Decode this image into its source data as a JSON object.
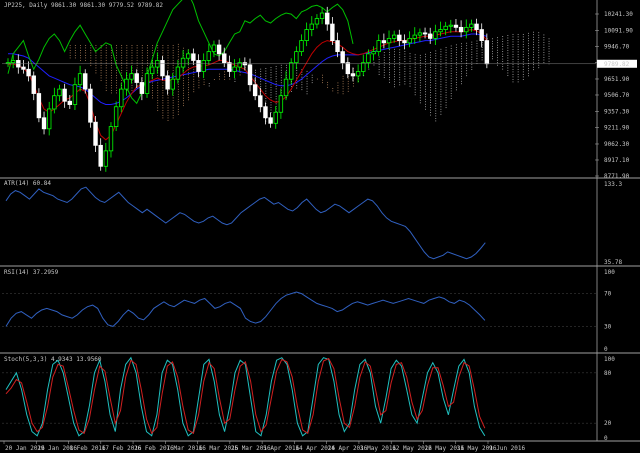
{
  "colors": {
    "background": "#000000",
    "separator": "#a0a0a0",
    "grid": "#3a3a3a",
    "text": "#c8c8c8",
    "bull_candle": "#00ff00",
    "bear_candle": "#ffffff",
    "tenkan": "#c00000",
    "kijun": "#2020ff",
    "chikou": "#00c000",
    "cloud_bull": "#d8d8d8",
    "cloud_bear": "#d8a070",
    "atr": "#3060c0",
    "rsi": "#3060c0",
    "stoch_main": "#20c0c0",
    "stoch_signal": "#d02020",
    "price_marker_bg": "#ffffff",
    "price_marker_text": "#000000"
  },
  "header": {
    "main": "JP225, Daily  9861.30 9861.30 9779.52 9789.82",
    "atr": "ATR(14) 60.84",
    "rsi": "RSI(14) 37.2959",
    "stoch": "Stoch(5,3,3) 4.9343 13.9560"
  },
  "price_marker": "9789.82",
  "chart_data": [
    {
      "type": "candlestick",
      "symbol": "JP225",
      "timeframe": "Daily",
      "yticks": [
        "10241.30",
        "10091.90",
        "9946.70",
        "9801.30",
        "9651.90",
        "9506.70",
        "9357.30",
        "9211.90",
        "9062.30",
        "8917.10",
        "8771.90"
      ],
      "ylim": [
        8771.9,
        10241.3
      ],
      "close": [
        9800,
        9820,
        9760,
        9740,
        9680,
        9520,
        9300,
        9200,
        9380,
        9500,
        9560,
        9450,
        9420,
        9600,
        9700,
        9560,
        9260,
        9050,
        8860,
        9000,
        9220,
        9400,
        9560,
        9650,
        9700,
        9620,
        9520,
        9700,
        9760,
        9820,
        9680,
        9560,
        9650,
        9760,
        9840,
        9880,
        9820,
        9720,
        9820,
        9900,
        9960,
        9880,
        9800,
        9720,
        9760,
        9800,
        9780,
        9600,
        9500,
        9400,
        9300,
        9250,
        9350,
        9500,
        9650,
        9800,
        9900,
        10000,
        10100,
        10150,
        10200,
        10250,
        10150,
        10000,
        9900,
        9800,
        9700,
        9680,
        9720,
        9800,
        9880,
        9900,
        10000,
        9980,
        10020,
        10050,
        10000,
        9980,
        10020,
        10050,
        10070,
        10060,
        10020,
        10080,
        10100,
        10130,
        10140,
        10120,
        10080,
        10120,
        10150,
        10100,
        10000,
        9790
      ],
      "ichimoku": {
        "tenkan": [
          9780,
          9790,
          9770,
          9750,
          9700,
          9600,
          9480,
          9380,
          9350,
          9380,
          9420,
          9460,
          9480,
          9520,
          9560,
          9540,
          9420,
          9260,
          9140,
          9100,
          9140,
          9240,
          9340,
          9440,
          9520,
          9580,
          9600,
          9620,
          9640,
          9660,
          9640,
          9640,
          9640,
          9660,
          9700,
          9740,
          9760,
          9770,
          9770,
          9780,
          9800,
          9820,
          9820,
          9800,
          9780,
          9760,
          9740,
          9680,
          9620,
          9560,
          9500,
          9460,
          9440,
          9450,
          9490,
          9560,
          9640,
          9720,
          9800,
          9880,
          9940,
          9980,
          10000,
          9990,
          9970,
          9940,
          9900,
          9880,
          9870,
          9880,
          9900,
          9920,
          9940,
          9960,
          9980,
          9990,
          10000,
          10000,
          10010,
          10020,
          10030,
          10040,
          10040,
          10050,
          10060,
          10070,
          10080,
          10080,
          10080,
          10090,
          10100,
          10090,
          10060,
          10000
        ],
        "kijun": [
          9880,
          9880,
          9870,
          9860,
          9840,
          9800,
          9760,
          9720,
          9680,
          9660,
          9640,
          9620,
          9600,
          9590,
          9580,
          9560,
          9520,
          9480,
          9440,
          9420,
          9420,
          9430,
          9450,
          9480,
          9520,
          9560,
          9590,
          9610,
          9630,
          9640,
          9650,
          9660,
          9670,
          9680,
          9690,
          9700,
          9710,
          9720,
          9730,
          9740,
          9740,
          9740,
          9740,
          9740,
          9730,
          9720,
          9710,
          9700,
          9680,
          9660,
          9640,
          9620,
          9600,
          9590,
          9590,
          9600,
          9620,
          9650,
          9690,
          9730,
          9770,
          9810,
          9840,
          9860,
          9870,
          9870,
          9870,
          9870,
          9870,
          9880,
          9890,
          9900,
          9910,
          9920,
          9930,
          9940,
          9950,
          9960,
          9970,
          9980,
          9990,
          10000,
          10000,
          10010,
          10020,
          10030,
          10040,
          10040,
          10040,
          10050,
          10060,
          10060,
          10050,
          10040
        ],
        "chikou_offset": 26
      }
    },
    {
      "type": "line",
      "indicator": "ATR(14)",
      "yticks": [
        "133.3",
        "35.78"
      ],
      "ylim": [
        35.78,
        133.3
      ],
      "values": [
        110,
        118,
        122,
        120,
        116,
        112,
        118,
        124,
        120,
        118,
        116,
        112,
        110,
        108,
        112,
        118,
        124,
        126,
        120,
        114,
        110,
        108,
        112,
        116,
        120,
        114,
        108,
        104,
        100,
        96,
        100,
        96,
        92,
        88,
        84,
        88,
        92,
        96,
        94,
        90,
        86,
        84,
        86,
        90,
        92,
        88,
        84,
        82,
        84,
        90,
        96,
        100,
        104,
        108,
        112,
        114,
        110,
        106,
        108,
        104,
        100,
        98,
        102,
        108,
        112,
        106,
        100,
        96,
        98,
        102,
        106,
        104,
        100,
        96,
        100,
        104,
        108,
        112,
        110,
        104,
        96,
        90,
        86,
        84,
        82,
        80,
        74,
        66,
        58,
        50,
        44,
        42,
        44,
        46,
        50,
        48,
        46,
        44,
        42,
        44,
        48,
        54,
        60.84
      ]
    },
    {
      "type": "line",
      "indicator": "RSI(14)",
      "yticks": [
        "100",
        "70",
        "30",
        "0"
      ],
      "ylim": [
        0,
        100
      ],
      "values": [
        30,
        40,
        46,
        48,
        44,
        40,
        46,
        50,
        52,
        50,
        48,
        44,
        42,
        40,
        44,
        50,
        54,
        56,
        52,
        40,
        32,
        30,
        36,
        44,
        50,
        46,
        40,
        38,
        44,
        52,
        56,
        60,
        56,
        54,
        58,
        62,
        60,
        58,
        62,
        64,
        58,
        52,
        54,
        58,
        60,
        56,
        52,
        40,
        36,
        34,
        36,
        42,
        50,
        58,
        64,
        68,
        70,
        72,
        70,
        66,
        62,
        58,
        56,
        54,
        52,
        48,
        50,
        54,
        58,
        60,
        58,
        56,
        58,
        60,
        62,
        60,
        58,
        60,
        62,
        64,
        62,
        60,
        58,
        62,
        64,
        66,
        64,
        60,
        58,
        62,
        60,
        56,
        50,
        44,
        37.3
      ]
    },
    {
      "type": "line",
      "indicator": "Stoch(5,3,3)",
      "yticks": [
        "100",
        "80",
        "20",
        "0"
      ],
      "ylim": [
        0,
        100
      ],
      "series": [
        {
          "values": [
            60,
            70,
            80,
            60,
            30,
            10,
            5,
            20,
            60,
            90,
            95,
            80,
            50,
            20,
            5,
            10,
            40,
            80,
            95,
            70,
            30,
            10,
            60,
            90,
            98,
            80,
            40,
            10,
            5,
            30,
            80,
            95,
            90,
            60,
            20,
            5,
            10,
            50,
            90,
            96,
            70,
            30,
            10,
            40,
            80,
            95,
            90,
            50,
            10,
            5,
            30,
            70,
            95,
            98,
            90,
            60,
            20,
            5,
            10,
            50,
            90,
            98,
            96,
            70,
            30,
            10,
            20,
            60,
            90,
            96,
            80,
            40,
            20,
            50,
            85,
            95,
            88,
            60,
            30,
            20,
            50,
            80,
            92,
            80,
            50,
            30,
            60,
            88,
            96,
            80,
            40,
            15,
            5
          ]
        },
        {
          "values": [
            55,
            62,
            72,
            68,
            45,
            20,
            10,
            15,
            40,
            75,
            90,
            88,
            62,
            35,
            12,
            8,
            25,
            60,
            88,
            82,
            50,
            20,
            35,
            75,
            95,
            90,
            60,
            25,
            8,
            15,
            55,
            88,
            93,
            75,
            40,
            12,
            8,
            30,
            70,
            92,
            85,
            50,
            20,
            25,
            60,
            88,
            93,
            70,
            30,
            10,
            18,
            50,
            82,
            96,
            93,
            75,
            40,
            12,
            8,
            30,
            70,
            94,
            97,
            85,
            50,
            20,
            15,
            40,
            75,
            93,
            88,
            60,
            30,
            35,
            68,
            90,
            92,
            75,
            45,
            25,
            35,
            65,
            86,
            86,
            65,
            40,
            45,
            75,
            92,
            88,
            60,
            28,
            14
          ]
        }
      ]
    }
  ],
  "xaxis": {
    "labels": [
      "20 Jan 2016",
      "29 Jan 2016",
      "8 Feb 2016",
      "17 Feb 2016",
      "26 Feb 2016",
      "7 Mar 2016",
      "16 Mar 2016",
      "25 Mar 2016",
      "5 Apr 2016",
      "14 Apr 2016",
      "24 Apr 2016",
      "3 May 2016",
      "12 May 2016",
      "22 May 2016",
      "31 May 2016",
      "9 Jun 2016"
    ]
  }
}
